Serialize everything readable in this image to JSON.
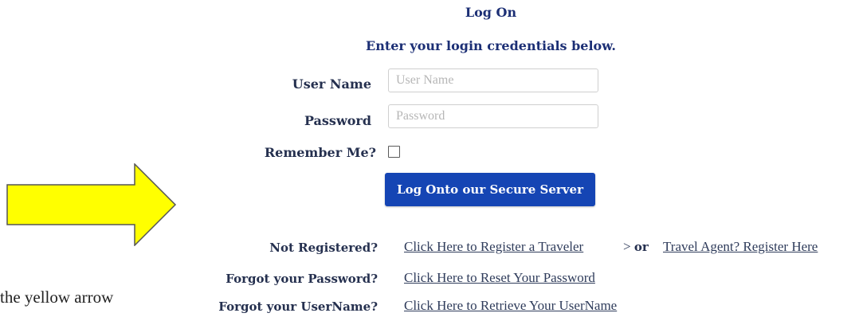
{
  "header": {
    "title": "Log On",
    "subtitle": "Enter your login credentials below."
  },
  "form": {
    "username_label": "User Name",
    "username_placeholder": "User Name",
    "username_value": "",
    "password_label": "Password",
    "password_placeholder": "Password",
    "password_value": "",
    "remember_label": "Remember Me?",
    "remember_checked": false,
    "submit_label": "Log Onto our Secure Server"
  },
  "links": {
    "not_registered_label": "Not Registered?",
    "register_traveler_link": "Click Here to Register a Traveler",
    "separator_arrow": ">",
    "separator_or": "or",
    "travel_agent_link": "Travel Agent? Register Here",
    "forgot_password_label": "Forgot your Password?",
    "reset_password_link": "Click Here to Reset Your Password",
    "forgot_username_label": "Forgot your UserName?",
    "retrieve_username_link": "Click Here to Retrieve Your UserName"
  },
  "annotation": {
    "caption": "the yellow arrow",
    "arrow_color": "#ffff00",
    "arrow_outline": "#555555"
  }
}
